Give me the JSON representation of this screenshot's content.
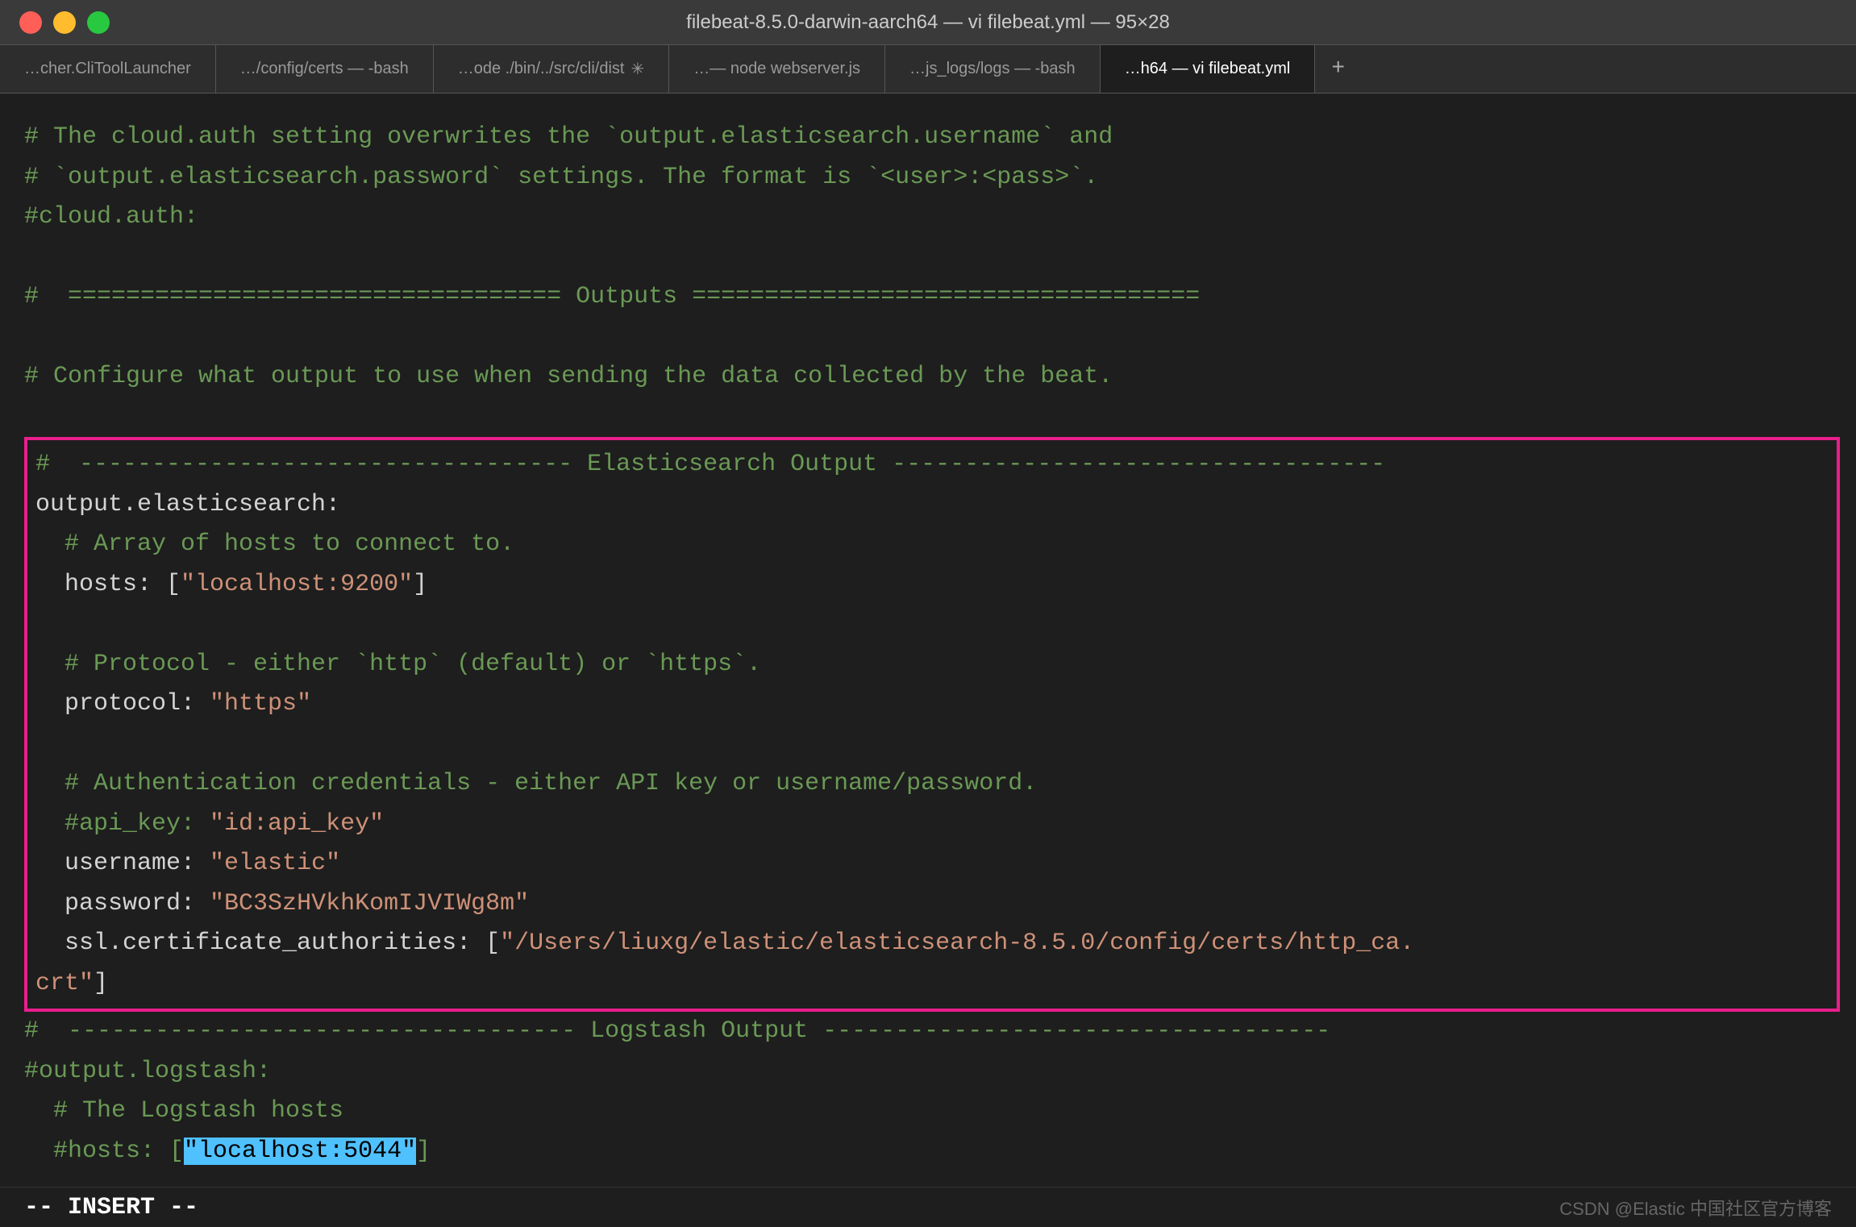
{
  "window": {
    "title": "filebeat-8.5.0-darwin-aarch64 — vi filebeat.yml — 95×28"
  },
  "tabs": [
    {
      "id": "tab1",
      "label": "…cher.CliToolLauncher",
      "active": false
    },
    {
      "id": "tab2",
      "label": "…/config/certs — -bash",
      "active": false
    },
    {
      "id": "tab3",
      "label": "…ode ./bin/../src/cli/dist",
      "active": false,
      "spinner": true
    },
    {
      "id": "tab4",
      "label": "…— node webserver.js",
      "active": false
    },
    {
      "id": "tab5",
      "label": "…js_logs/logs — -bash",
      "active": false
    },
    {
      "id": "tab6",
      "label": "…h64 — vi filebeat.yml",
      "active": true
    }
  ],
  "code": {
    "above_box": [
      "# The cloud.auth setting overwrites the `output.elasticsearch.username` and",
      "# `output.elasticsearch.password` settings. The format is `<user>:<pass>`.",
      "#cloud.auth:",
      "",
      "#  ================================== Outputs ===================================",
      "",
      "# Configure what output to use when sending the data collected by the beat."
    ],
    "highlighted_box": [
      "#  ---------------------------------- Elasticsearch Output ----------------------------------",
      "output.elasticsearch:",
      "  # Array of hosts to connect to.",
      "  hosts: [\"localhost:9200\"]",
      "",
      "  # Protocol - either `http` (default) or `https`.",
      "  protocol: \"https\"",
      "",
      "  # Authentication credentials - either API key or username/password.",
      "  #api_key: \"id:api_key\"",
      "  username: \"elastic\"",
      "  password: \"BC3SzHVkhKomIJVIWg8m\"",
      "  ssl.certificate_authorities: [\"/Users/liuxg/elastic/elasticsearch-8.5.0/config/certs/http_ca.",
      "crt\"]"
    ],
    "below_box": [
      "#  ----------------------------------- Logstash Output -----------------------------------",
      "#output.logstash:",
      "  # The Logstash hosts",
      "  #hosts: [\"localhost:5044\"]"
    ]
  },
  "status": {
    "mode": "-- INSERT --",
    "credit": "CSDN @Elastic 中国社区官方博客"
  }
}
